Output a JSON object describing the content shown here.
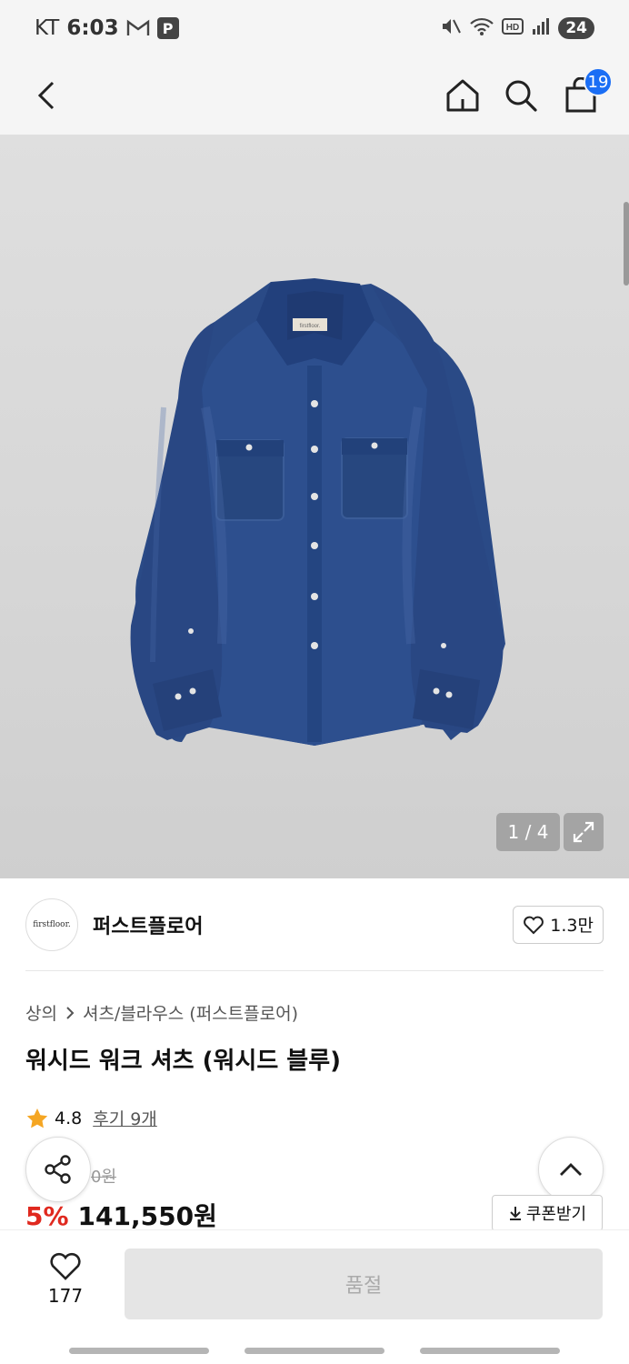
{
  "status_bar": {
    "carrier": "KT",
    "time": "6:03",
    "p_badge": "P",
    "battery": "24"
  },
  "nav": {
    "cart_count": "19"
  },
  "gallery": {
    "counter": "1 / 4",
    "shirt_label": "firstfloor."
  },
  "brand": {
    "logo_text": "firstfloor.",
    "name": "퍼스트플로어",
    "likes": "1.3만"
  },
  "breadcrumb": {
    "category": "상의",
    "subcategory": "셔츠/블라우스 (퍼스트플로어)"
  },
  "product": {
    "title": "워시드 워크 셔츠 (워시드 블루)",
    "rating": "4.8",
    "reviews": "후기 9개",
    "original_price": "0원",
    "discount": "5%",
    "price": "141,550원"
  },
  "actions": {
    "coupon": "쿠폰받기",
    "wish_count": "177",
    "buy_button": "품절"
  },
  "colors": {
    "accent_blue": "#1a6ef5",
    "discount_red": "#e0291f",
    "denim": "#2a4a86",
    "star": "#f5a623"
  }
}
